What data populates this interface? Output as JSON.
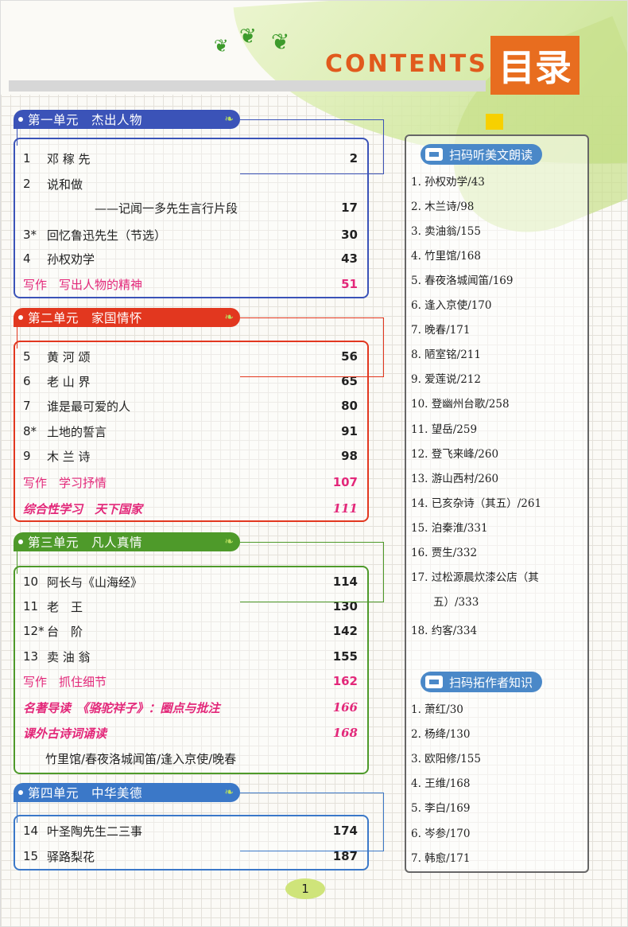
{
  "header": {
    "contents": "CONTENTS",
    "mulu": "目录"
  },
  "units": [
    {
      "title": "第一单元　杰出人物",
      "color": "#3b53b8",
      "items": [
        {
          "num": "1",
          "title": "邓 稼 先",
          "page": "2"
        },
        {
          "num": "2",
          "title": "说和做",
          "page": ""
        },
        {
          "num": "",
          "title": "——记闻一多先生言行片段",
          "page": "17",
          "sub": true
        },
        {
          "num": "3*",
          "title": "回忆鲁迅先生（节选）",
          "page": "30"
        },
        {
          "num": "4",
          "title": "孙权劝学",
          "page": "43"
        },
        {
          "num": "",
          "title": "写作　写出人物的精神",
          "page": "51",
          "style": "red"
        }
      ]
    },
    {
      "title": "第二单元　家国情怀",
      "color": "#e2371f",
      "items": [
        {
          "num": "5",
          "title": "黄 河 颂",
          "page": "56"
        },
        {
          "num": "6",
          "title": "老 山 界",
          "page": "65"
        },
        {
          "num": "7",
          "title": "谁是最可爱的人",
          "page": "80"
        },
        {
          "num": "8*",
          "title": "土地的誓言",
          "page": "91"
        },
        {
          "num": "9",
          "title": "木 兰 诗",
          "page": "98"
        },
        {
          "num": "",
          "title": "写作　学习抒情",
          "page": "107",
          "style": "red"
        },
        {
          "num": "",
          "title": "综合性学习　天下国家",
          "page": "111",
          "style": "cal"
        }
      ]
    },
    {
      "title": "第三单元　凡人真情",
      "color": "#4e9a2a",
      "items": [
        {
          "num": "10",
          "title": "阿长与《山海经》",
          "page": "114"
        },
        {
          "num": "11",
          "title": "老　王",
          "page": "130"
        },
        {
          "num": "12*",
          "title": "台　阶",
          "page": "142"
        },
        {
          "num": "13",
          "title": "卖 油 翁",
          "page": "155"
        },
        {
          "num": "",
          "title": "写作　抓住细节",
          "page": "162",
          "style": "red"
        },
        {
          "num": "",
          "title": "名著导读　《骆驼祥子》：圈点与批注",
          "page": "166",
          "style": "cal"
        },
        {
          "num": "",
          "title": "课外古诗词诵读",
          "page": "168",
          "style": "cal"
        },
        {
          "num": "",
          "title": "竹里馆/春夜洛城闻笛/逢入京使/晚春",
          "page": "",
          "sub2": true
        }
      ]
    },
    {
      "title": "第四单元　中华美德",
      "color": "#3b78c8",
      "items": [
        {
          "num": "14",
          "title": "叶圣陶先生二三事",
          "page": "174"
        },
        {
          "num": "15",
          "title": "驿路梨花",
          "page": "187"
        }
      ]
    }
  ],
  "listen": {
    "title": "扫码听美文朗读",
    "items": [
      "1. 孙权劝学/43",
      "2. 木兰诗/98",
      "3. 卖油翁/155",
      "4. 竹里馆/168",
      "5. 春夜洛城闻笛/169",
      "6. 逢入京使/170",
      "7. 晚春/171",
      "8. 陋室铭/211",
      "9. 爱莲说/212",
      "10. 登幽州台歌/258",
      "11. 望岳/259",
      "12. 登飞来峰/260",
      "13. 游山西村/260",
      "14. 已亥杂诗（其五）/261",
      "15. 泊秦淮/331",
      "16. 贾生/332",
      "17. 过松源晨炊漆公店（其",
      "五）/333",
      "18. 约客/334"
    ]
  },
  "authors": {
    "title": "扫码拓作者知识",
    "items": [
      "1. 萧红/30",
      "2. 杨绛/130",
      "3. 欧阳修/155",
      "4. 王维/168",
      "5. 李白/169",
      "6. 岑参/170",
      "7. 韩愈/171"
    ]
  },
  "page_number": "1"
}
